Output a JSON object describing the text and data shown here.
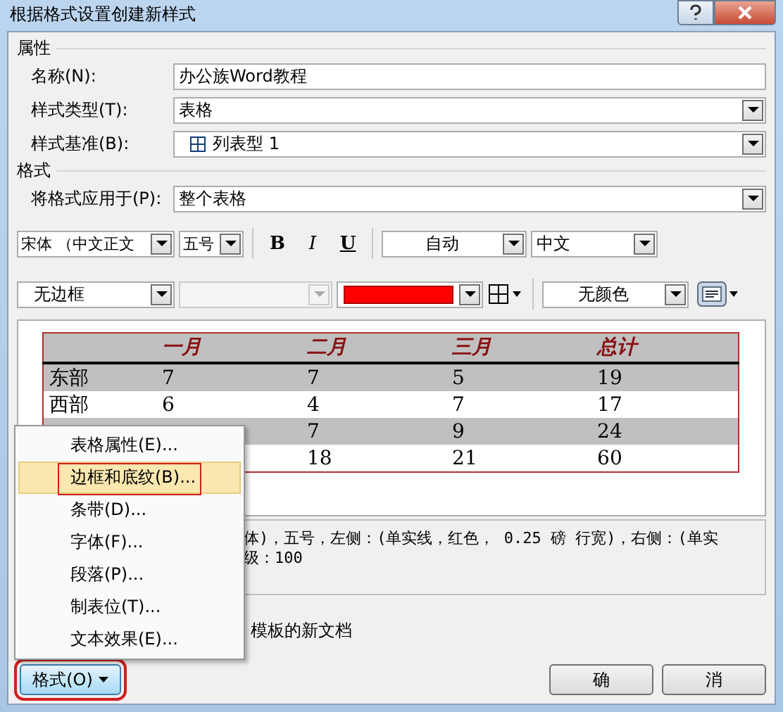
{
  "window": {
    "title": "根据格式设置创建新样式"
  },
  "properties": {
    "heading": "属性",
    "fields": [
      {
        "label": "名称(N):",
        "kind": "text",
        "value": "办公族Word教程"
      },
      {
        "label": "样式类型(T):",
        "kind": "dropdown",
        "value": "表格"
      },
      {
        "label": "样式基准(B):",
        "kind": "table-dropdown",
        "value": "列表型 1"
      }
    ]
  },
  "format": {
    "heading": "格式",
    "apply_label": "将格式应用于(P):",
    "apply_value": "整个表格",
    "font": "宋体 （中文正文",
    "size": "五号",
    "bold": "B",
    "italic": "I",
    "underline": "U",
    "font_color": "自动",
    "script": "中文",
    "border_style": "无边框",
    "shading": "无颜色"
  },
  "preview": {
    "columns": [
      "一月",
      "二月",
      "三月",
      "总计"
    ],
    "rows": [
      {
        "label": "东部",
        "cells": [
          "7",
          "7",
          "5",
          "19"
        ],
        "shaded": true
      },
      {
        "label": "西部",
        "cells": [
          "6",
          "4",
          "7",
          "17"
        ],
        "shaded": false
      },
      {
        "cells": [
          null,
          "7",
          "9",
          "24"
        ],
        "shaded": true
      },
      {
        "cells": [
          null,
          "18",
          "21",
          "60"
        ],
        "shaded": false
      }
    ]
  },
  "description": [
    "体)，五号，左侧：(单实线，红色， 0.25 磅 行宽)，右侧：(单实",
    "级：100"
  ],
  "radio_text": "模板的新文档",
  "menu": [
    {
      "label": "表格属性(E)...",
      "selected": false
    },
    {
      "label": "边框和底纹(B)...",
      "selected": true
    },
    {
      "label": "条带(D)...",
      "selected": false
    },
    {
      "label": "字体(F)...",
      "selected": false
    },
    {
      "label": "段落(P)...",
      "selected": false
    },
    {
      "label": "制表位(T)...",
      "selected": false
    },
    {
      "label": "文本效果(E)...",
      "selected": false
    }
  ],
  "format_button": "格式(O)",
  "buttons": [
    "确",
    "消"
  ]
}
